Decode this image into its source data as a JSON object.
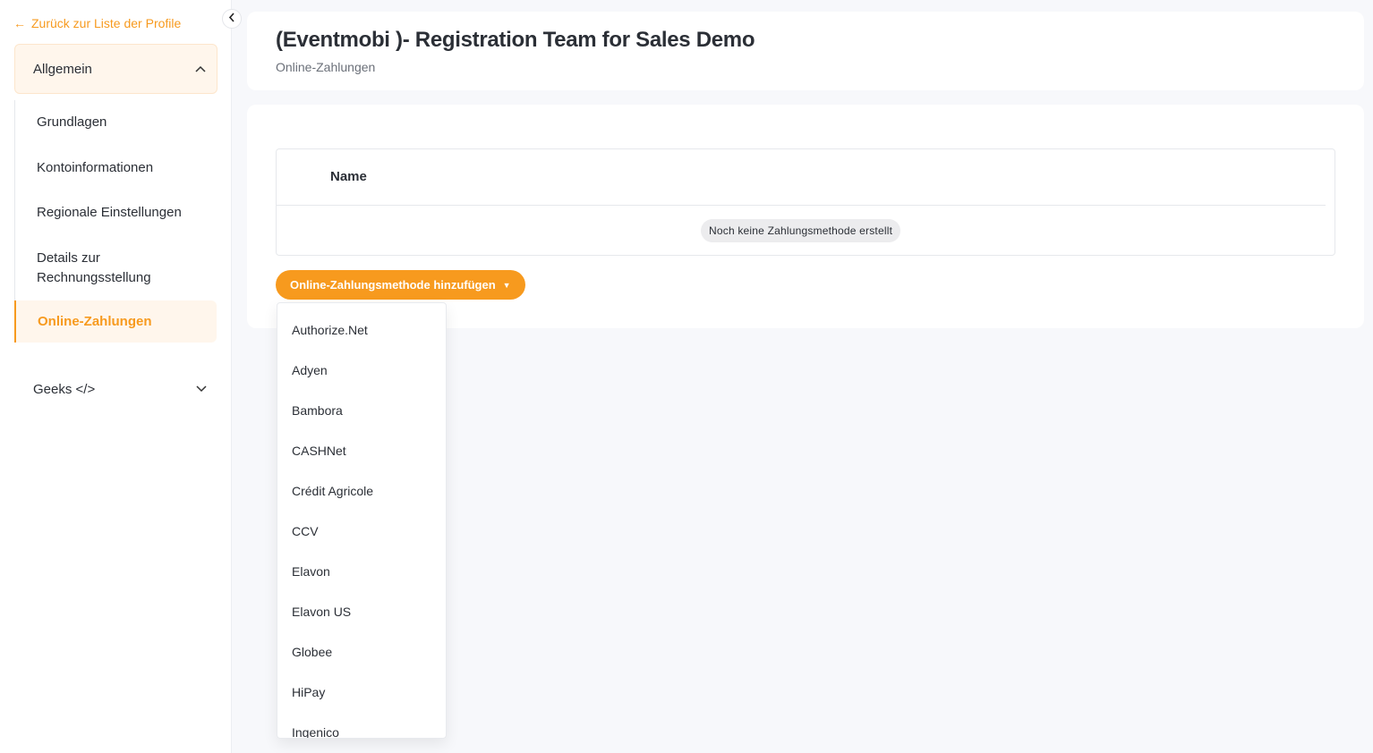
{
  "sidebar": {
    "back_label": "Zurück zur Liste der Profile",
    "group_general": "Allgemein",
    "items": [
      {
        "label": "Grundlagen"
      },
      {
        "label": "Kontoinformationen"
      },
      {
        "label": "Regionale Einstellungen"
      },
      {
        "label": "Details zur\nRechnungsstellung"
      },
      {
        "label": "Online-Zahlungen"
      }
    ],
    "group_geeks": "Geeks </>"
  },
  "header": {
    "title": "(Eventmobi )- Registration Team for Sales Demo",
    "subtitle": "Online-Zahlungen"
  },
  "table": {
    "column_name": "Name",
    "empty_text": "Noch keine Zahlungsmethode erstellt"
  },
  "add_button": {
    "label": "Online-Zahlungsmethode hinzufügen"
  },
  "dropdown": {
    "options": [
      "Authorize.Net",
      "Adyen",
      "Bambora",
      "CASHNet",
      "Crédit Agricole",
      "CCV",
      "Elavon",
      "Elavon US",
      "Globee",
      "HiPay",
      "Ingenico"
    ]
  },
  "colors": {
    "accent": "#f79a1e",
    "accent_bg": "#fff6ec",
    "page_bg": "#f7f8fb"
  },
  "icons": {
    "back": "arrow-left-icon",
    "collapse": "chevron-left-icon",
    "group_open": "chevron-up-icon",
    "group_closed": "chevron-down-icon",
    "dropdown": "caret-down-icon"
  }
}
